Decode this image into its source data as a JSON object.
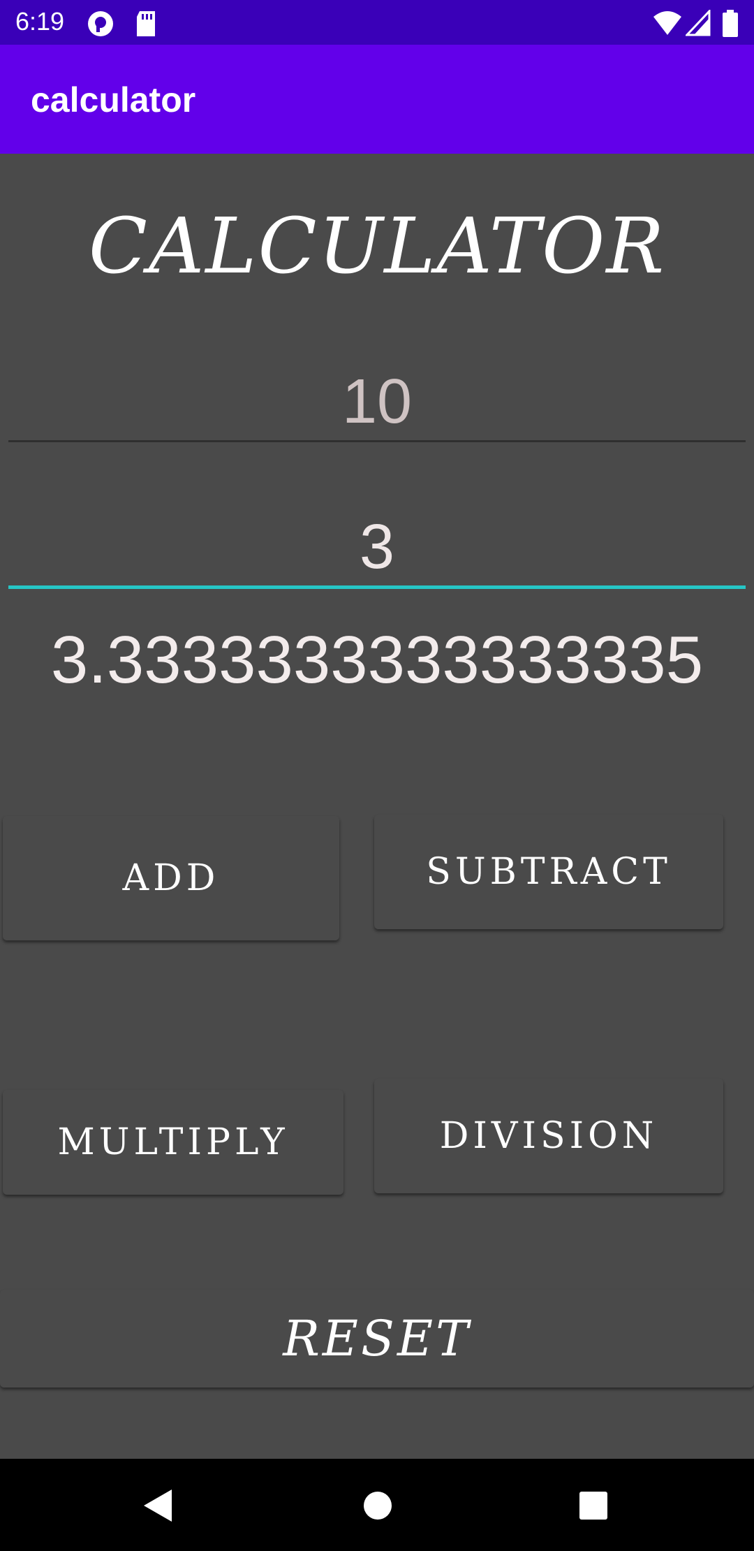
{
  "status_bar": {
    "time": "6:19",
    "icons": [
      "pocket-casts-icon",
      "sd-card-icon",
      "wifi-icon",
      "signal-icon",
      "battery-icon"
    ],
    "background": "#3a00b8"
  },
  "app_bar": {
    "title": "calculator",
    "background": "#6200ea"
  },
  "heading": "CALCULATOR",
  "inputs": {
    "first_value": "10",
    "second_value": "3"
  },
  "result": "3.3333333333333335",
  "buttons": {
    "add": "ADD",
    "subtract": "SUBTRACT",
    "multiply": "MULTIPLY",
    "division": "DIVISION",
    "reset": "RESET"
  },
  "nav_bar": {
    "icons": [
      "back-icon",
      "home-icon",
      "recents-icon"
    ]
  },
  "colors": {
    "accent_underline": "#26c6c6",
    "background": "#4a4a4a"
  }
}
